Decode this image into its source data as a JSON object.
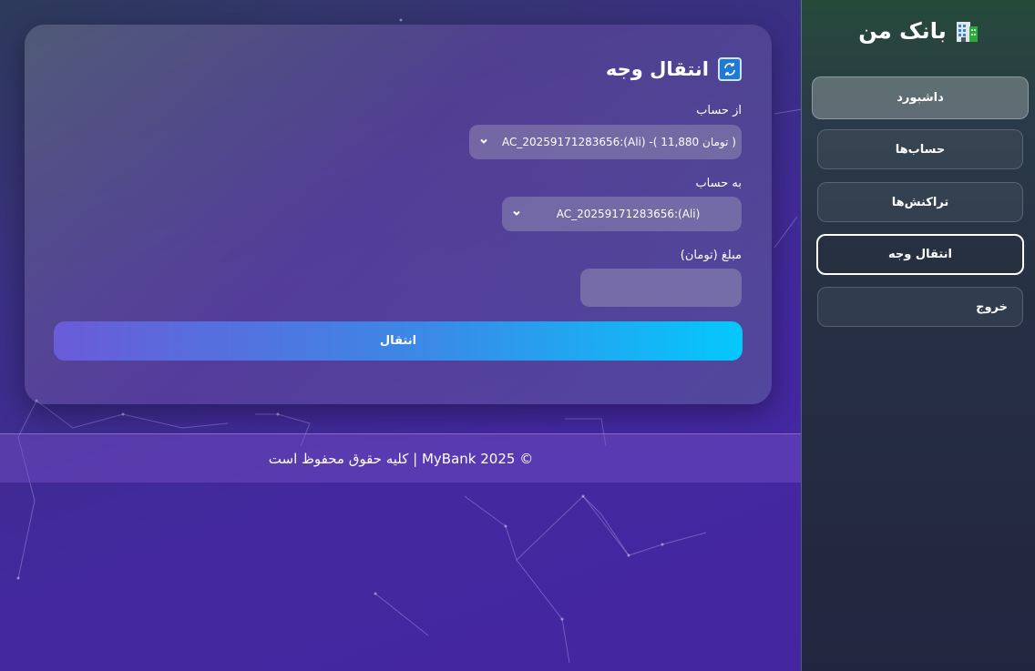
{
  "sidebar": {
    "brand": "بانک من",
    "brand_icon": "bank-building-icon",
    "items": [
      {
        "label": "داشبورد"
      },
      {
        "label": "حساب‌ها"
      },
      {
        "label": "تراکنش‌ها"
      },
      {
        "label": "انتقال وجه"
      },
      {
        "label": "خروج"
      }
    ],
    "active_index": 3
  },
  "transfer": {
    "title": "انتقال وجه",
    "title_icon": "swap-arrows-icon",
    "from_label": "از حساب",
    "from_value": "AC_20259171283656:(Ali) -( 11,880 تومان )",
    "to_label": "به حساب",
    "to_value": "AC_20259171283656:(Ali)",
    "amount_label": "مبلغ (تومان)",
    "amount_value": "",
    "submit_label": "انتقال"
  },
  "footer": {
    "text": "© 2025 MyBank | کلیه حقوق محفوظ است"
  },
  "colors": {
    "button_gradient_start": "#6a5bd8",
    "button_gradient_end": "#04c8fc",
    "background": "#4426a0",
    "active_border": "#ffffff"
  }
}
